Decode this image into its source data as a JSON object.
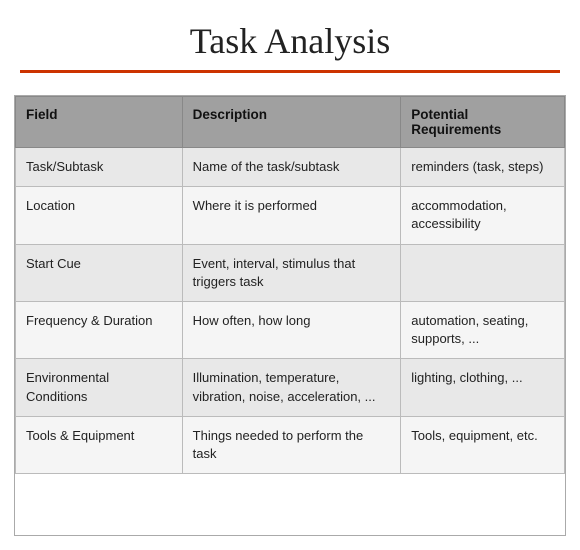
{
  "title": "Task Analysis",
  "table": {
    "headers": [
      {
        "id": "field",
        "label": "Field"
      },
      {
        "id": "description",
        "label": "Description"
      },
      {
        "id": "requirements",
        "label": "Potential Requirements"
      }
    ],
    "rows": [
      {
        "field": "Task/Subtask",
        "description": "Name of the task/subtask",
        "requirements": "reminders (task, steps)"
      },
      {
        "field": "Location",
        "description": "Where it is performed",
        "requirements": "accommodation, accessibility"
      },
      {
        "field": "Start Cue",
        "description": "Event, interval, stimulus that triggers task",
        "requirements": ""
      },
      {
        "field": "Frequency & Duration",
        "description": "How often, how long",
        "requirements": "automation, seating, supports, ..."
      },
      {
        "field": "Environmental Conditions",
        "description": "Illumination, temperature, vibration, noise, acceleration, ...",
        "requirements": "lighting, clothing, ..."
      },
      {
        "field": "Tools & Equipment",
        "description": "Things needed to perform the task",
        "requirements": "Tools, equipment, etc."
      }
    ]
  }
}
